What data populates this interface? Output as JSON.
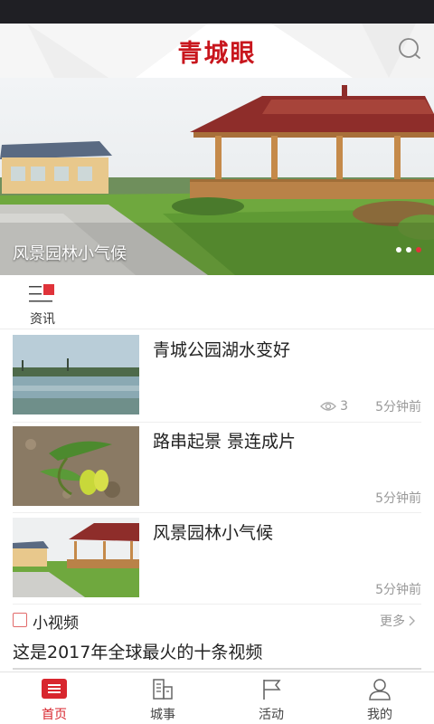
{
  "app": {
    "title": "青城眼"
  },
  "banner": {
    "caption": "风景园林小气候",
    "dots_count": 3,
    "active_dot": 3
  },
  "channel": {
    "label": "资讯",
    "icon": "news-channel-icon"
  },
  "news": [
    {
      "title": "青城公园湖水变好",
      "views": "3",
      "time": "5分钟前"
    },
    {
      "title": "路串起景 景连成片",
      "views": "",
      "time": "5分钟前"
    },
    {
      "title": "风景园林小气候",
      "views": "",
      "time": "5分钟前"
    }
  ],
  "video_section": {
    "title": "小视频",
    "more_label": "更多",
    "headline": "这是2017年全球最火的十条视频"
  },
  "tabs": [
    {
      "label": "首页",
      "icon": "home-icon",
      "active": true
    },
    {
      "label": "城事",
      "icon": "city-icon",
      "active": false
    },
    {
      "label": "活动",
      "icon": "flag-icon",
      "active": false
    },
    {
      "label": "我的",
      "icon": "user-icon",
      "active": false
    }
  ],
  "colors": {
    "accent": "#d8262e",
    "title_red": "#c8161d",
    "status_bar": "#1f1f24"
  }
}
